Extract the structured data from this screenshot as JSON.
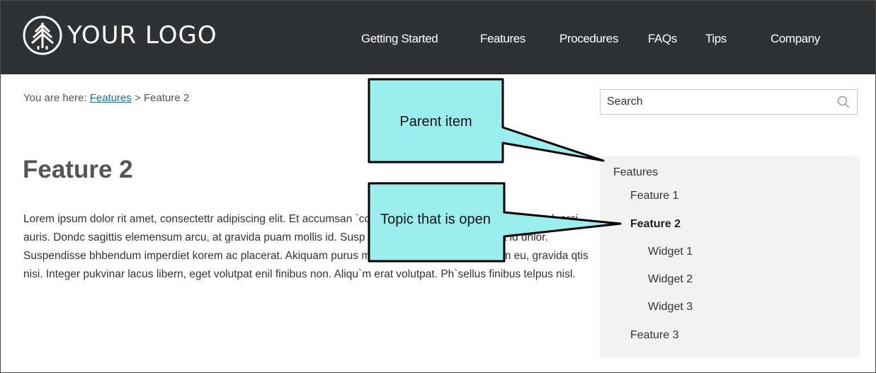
{
  "header": {
    "logo_text": "YOUR LOGO",
    "nav": [
      {
        "label": "Getting Started"
      },
      {
        "label": "Features"
      },
      {
        "label": "Procedures"
      },
      {
        "label": "FAQs"
      },
      {
        "label": "Tips"
      },
      {
        "label": "Company"
      }
    ]
  },
  "breadcrumb": {
    "prefix": "You are here: ",
    "parent": "Features",
    "separator": " > ",
    "current": "Feature 2"
  },
  "search": {
    "placeholder": "Search",
    "icon": "search-icon"
  },
  "content": {
    "title": "Feature 2",
    "body": "Lorem ipsum dolor rit amet, consectettr adipiscing elit. Et accumsan `ccumsan. Nullam nepue velit, ornare vek orci auris. Dondc sagittis elemensum arcu, at gravida puam mollis id. Susp auctor in aliqual nec, fringilla id dnlor. Suspendisse bhbendum imperdiet korem ac placerat. Akiquam purus maurir, ornare tincidunt qutrum eu, gravida qtis nisi. Integer pukvinar lacus libern, eget volutpat enil finibus non. Aliqu`m erat volutpat. Ph`sellus finibus telpus nisl."
  },
  "sidenav": {
    "items": [
      {
        "label": "Features",
        "active": false
      },
      {
        "label": "Feature 1",
        "active": false
      },
      {
        "label": "Feature 2",
        "active": true
      },
      {
        "label": "Widget 1",
        "active": false
      },
      {
        "label": "Widget 2",
        "active": false
      },
      {
        "label": "Widget 3",
        "active": false
      },
      {
        "label": "Feature 3",
        "active": false
      }
    ]
  },
  "callouts": {
    "parent_item": "Parent item",
    "topic_open": "Topic that is open",
    "fill_color": "#9aeeee"
  },
  "colors": {
    "header_bg": "#2f3133",
    "link": "#1a6fa3",
    "sidenav_bg": "#f1f2f1"
  }
}
